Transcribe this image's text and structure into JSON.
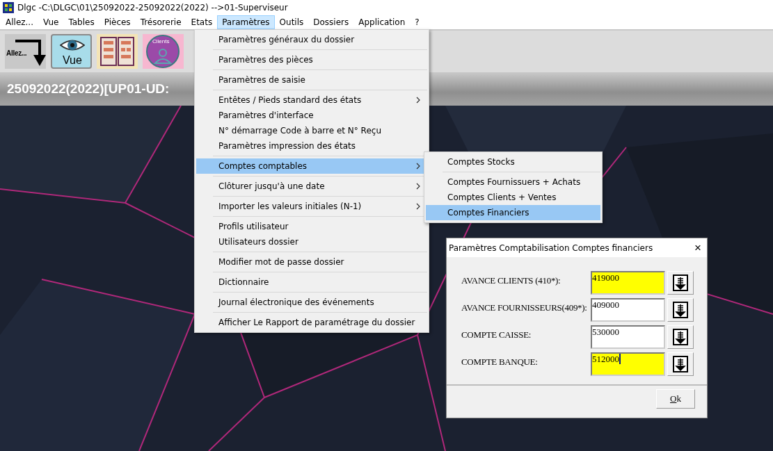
{
  "window": {
    "title": "Dlgc -C:\\DLGC\\01\\25092022-25092022(2022) -->01-Superviseur"
  },
  "menu_bar": [
    {
      "label": "Allez...",
      "selected": false
    },
    {
      "label": "Vue",
      "selected": false
    },
    {
      "label": "Tables",
      "selected": false
    },
    {
      "label": "Pièces",
      "selected": false
    },
    {
      "label": "Trésorerie",
      "selected": false
    },
    {
      "label": "Etats",
      "selected": false
    },
    {
      "label": "Paramètres",
      "selected": true
    },
    {
      "label": "Outils",
      "selected": false
    },
    {
      "label": "Dossiers",
      "selected": false
    },
    {
      "label": "Application",
      "selected": false
    },
    {
      "label": "?",
      "selected": false
    }
  ],
  "toolbar": [
    {
      "kind": "goto",
      "label": "Allez..."
    },
    {
      "kind": "view",
      "label": "Vue"
    },
    {
      "kind": "tables"
    },
    {
      "kind": "clients",
      "label": "Clients"
    }
  ],
  "header": {
    "text": "25092022(2022)[UP01-UD:"
  },
  "background": {
    "kind": "picture"
  },
  "dropdown": [
    [
      {
        "label": "Paramètres généraux du dossier",
        "submenu": false,
        "selected": false
      }
    ],
    [
      {
        "label": "Paramètres des pièces",
        "submenu": false,
        "selected": false
      }
    ],
    [
      {
        "label": "Paramètres de saisie",
        "submenu": false,
        "selected": false
      }
    ],
    [
      {
        "label": "Entêtes / Pieds standard des états",
        "submenu": true,
        "selected": false
      },
      {
        "label": "Paramètres d'interface",
        "submenu": false,
        "selected": false
      },
      {
        "label": "N° démarrage Code à barre et N° Reçu",
        "submenu": false,
        "selected": false
      },
      {
        "label": "Paramètres impression des états",
        "submenu": false,
        "selected": false
      }
    ],
    [
      {
        "label": "Comptes comptables",
        "submenu": true,
        "selected": true
      }
    ],
    [
      {
        "label": "Clôturer jusqu'à une date",
        "submenu": true,
        "selected": false
      }
    ],
    [
      {
        "label": "Importer les valeurs initiales (N-1)",
        "submenu": true,
        "selected": false
      }
    ],
    [
      {
        "label": "Profils utilisateur",
        "submenu": false,
        "selected": false
      },
      {
        "label": "Utilisateurs dossier",
        "submenu": false,
        "selected": false
      }
    ],
    [
      {
        "label": "Modifier mot de passe dossier",
        "submenu": false,
        "selected": false
      }
    ],
    [
      {
        "label": "Dictionnaire",
        "submenu": false,
        "selected": false
      }
    ],
    [
      {
        "label": "Journal électronique des événements",
        "submenu": false,
        "selected": false
      }
    ],
    [
      {
        "label": "Afficher Le Rapport de paramétrage du dossier",
        "submenu": false,
        "selected": false
      }
    ]
  ],
  "submenu": [
    [
      {
        "label": "Comptes Stocks",
        "selected": false
      }
    ],
    [
      {
        "label": "Comptes Fournissuers + Achats",
        "selected": false
      },
      {
        "label": "Comptes Clients + Ventes",
        "selected": false
      },
      {
        "label": "Comptes Financiers",
        "selected": true
      }
    ]
  ],
  "dialog": {
    "title": "Paramètres Comptabilisation Comptes financiers",
    "close": "×",
    "fields": [
      {
        "label": "AVANCE CLIENTS (410*):",
        "value": "419000",
        "highlighted": true,
        "focused": false
      },
      {
        "label": "AVANCE FOURNISSEURS(409*):",
        "value": "409000",
        "highlighted": false,
        "focused": false
      },
      {
        "label": "COMPTE CAISSE:",
        "value": "530000",
        "highlighted": false,
        "focused": false
      },
      {
        "label": "COMPTE BANQUE:",
        "value": "512000",
        "highlighted": true,
        "focused": true
      }
    ],
    "ok_button": "Ok"
  }
}
